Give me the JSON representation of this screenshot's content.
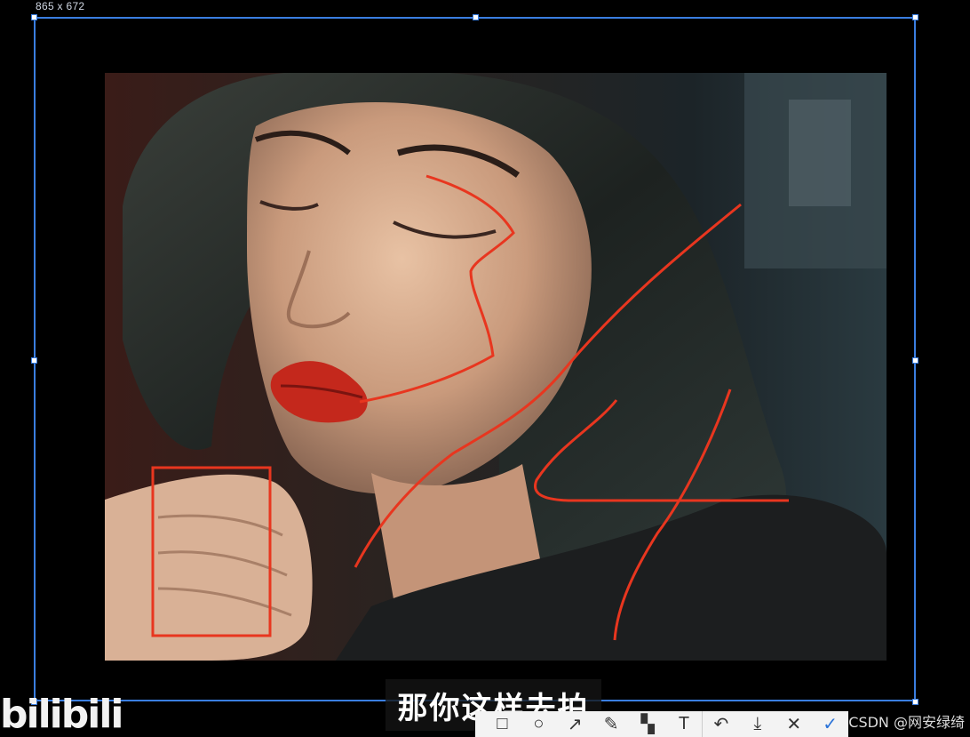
{
  "selection": {
    "size_label": "865 x 672"
  },
  "subtitle": {
    "text": "那你这样去拍"
  },
  "watermark": {
    "text": "CSDN @网安绿绮"
  },
  "logo": {
    "text": "bilibili"
  },
  "toolbar": {
    "tools": [
      {
        "name": "rectangle-tool",
        "icon": "rectangle-icon",
        "glyph": "□"
      },
      {
        "name": "ellipse-tool",
        "icon": "ellipse-icon",
        "glyph": "○"
      },
      {
        "name": "arrow-tool",
        "icon": "arrow-icon",
        "glyph": "↗"
      },
      {
        "name": "pen-tool",
        "icon": "pen-icon",
        "glyph": "✎"
      },
      {
        "name": "mosaic-tool",
        "icon": "mosaic-icon",
        "glyph": "▚"
      },
      {
        "name": "text-tool",
        "icon": "text-icon",
        "glyph": "T"
      },
      {
        "name": "undo-button",
        "icon": "undo-icon",
        "glyph": "↶"
      },
      {
        "name": "save-button",
        "icon": "download-icon",
        "glyph": "⤓"
      },
      {
        "name": "cancel-button",
        "icon": "close-icon",
        "glyph": "✕"
      },
      {
        "name": "confirm-button",
        "icon": "check-icon",
        "glyph": "✓"
      }
    ]
  },
  "colors": {
    "selection_border": "#3a7ee0",
    "annotation": "#e8361f",
    "background": "#000000"
  }
}
